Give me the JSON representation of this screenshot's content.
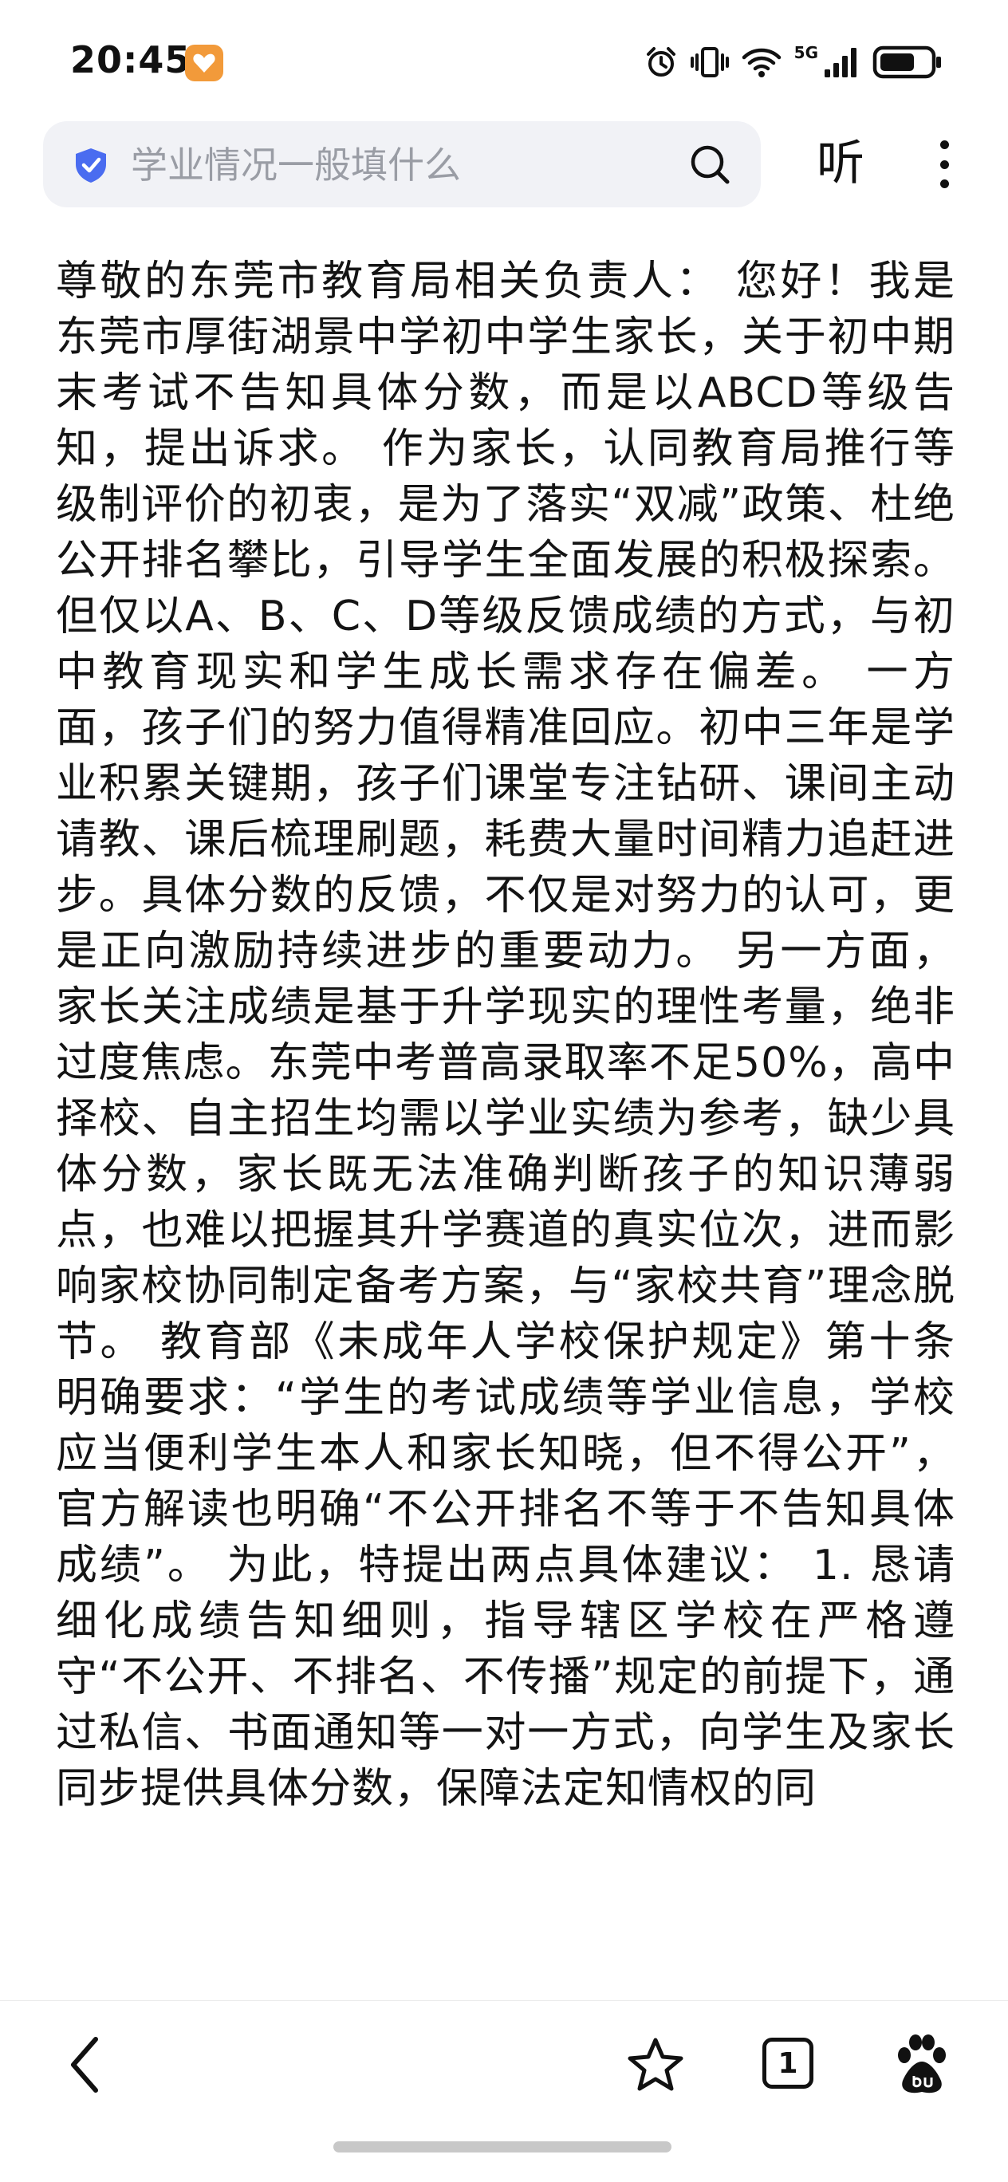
{
  "status_bar": {
    "time": "20:45",
    "network": "5G"
  },
  "search": {
    "query": "学业情况一般填什么"
  },
  "header": {
    "listen_label": "听"
  },
  "article": {
    "body": "尊敬的东莞市教育局相关负责人： 您好！我是东莞市厚街湖景中学初中学生家长，关于初中期末考试不告知具体分数，而是以ABCD等级告知，提出诉求。 作为家长，认同教育局推行等级制评价的初衷，是为了落实“双减”政策、杜绝公开排名攀比，引导学生全面发展的积极探索。 但仅以A、B、C、D等级反馈成绩的方式，与初中教育现实和学生成长需求存在偏差。 一方面，孩子们的努力值得精准回应。初中三年是学业积累关键期，孩子们课堂专注钻研、课间主动请教、课后梳理刷题，耗费大量时间精力追赶进步。具体分数的反馈，不仅是对努力的认可，更是正向激励持续进步的重要动力。 另一方面，家长关注成绩是基于升学现实的理性考量，绝非过度焦虑。东莞中考普高录取率不足50%，高中择校、自主招生均需以学业实绩为参考，缺少具体分数，家长既无法准确判断孩子的知识薄弱点，也难以把握其升学赛道的真实位次，进而影响家校协同制定备考方案，与“家校共育”理念脱节。 教育部《未成年人学校保护规定》第十条明确要求：“学生的考试成绩等学业信息，学校应当便利学生本人和家长知晓，但不得公开”，官方解读也明确“不公开排名不等于不告知具体成绩”。 为此，特提出两点具体建议： 1. 恳请细化成绩告知细则，指导辖区学校在严格遵守“不公开、不排名、不传播”规定的前提下，通过私信、书面通知等一对一方式，向学生及家长同步提供具体分数，保障法定知情权的同"
  },
  "bottom_nav": {
    "tab_count": "1"
  }
}
